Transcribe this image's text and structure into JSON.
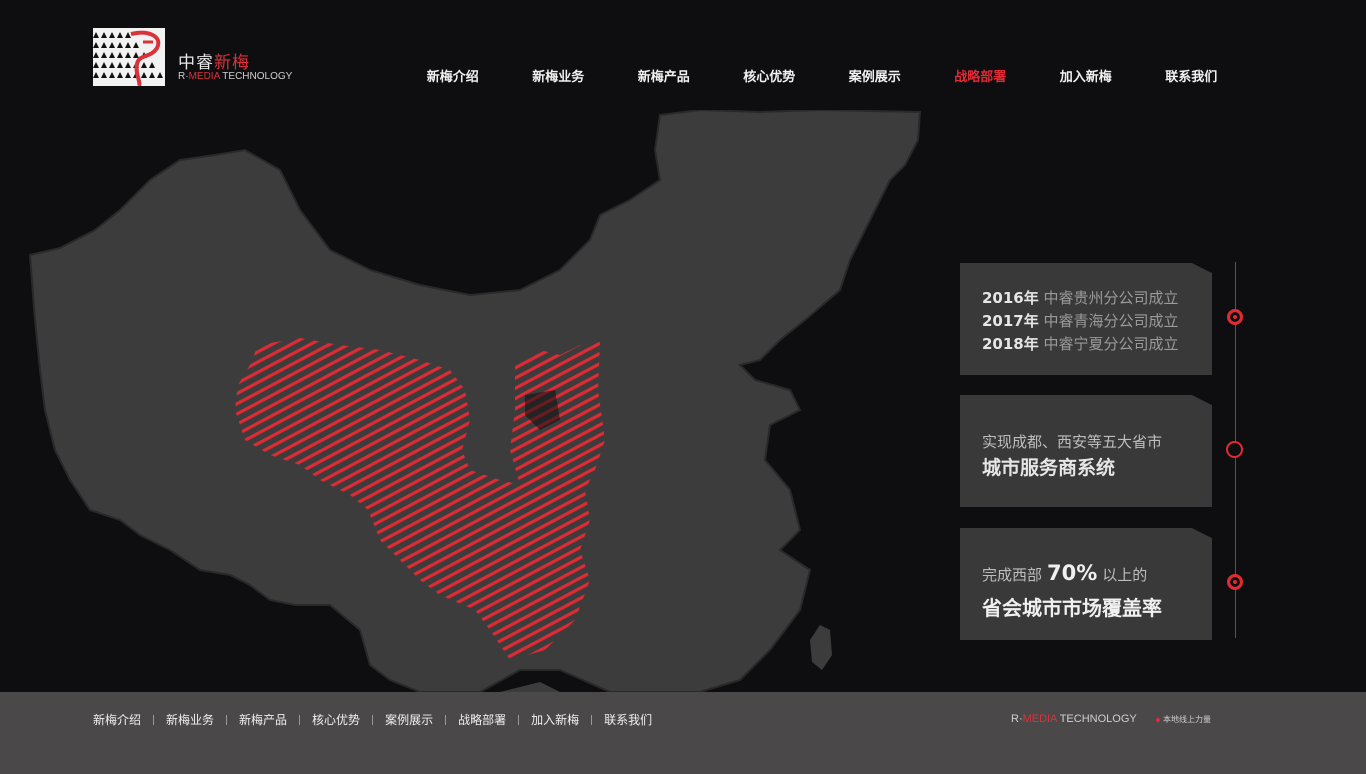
{
  "logo": {
    "cn_part1": "中睿",
    "cn_part2": "新梅",
    "en_prefix": "R·",
    "en_red": "MEDIA",
    "en_suffix": " TECHNOLOGY"
  },
  "nav": {
    "items": [
      {
        "label": "新梅介绍"
      },
      {
        "label": "新梅业务"
      },
      {
        "label": "新梅产品"
      },
      {
        "label": "核心优势"
      },
      {
        "label": "案例展示"
      },
      {
        "label": "战略部署"
      },
      {
        "label": "加入新梅"
      },
      {
        "label": "联系我们"
      }
    ],
    "active_index": 5
  },
  "timeline": {
    "card1": {
      "lines": [
        {
          "year": "2016年",
          "text": " 中睿贵州分公司成立"
        },
        {
          "year": "2017年",
          "text": " 中睿青海分公司成立"
        },
        {
          "year": "2018年",
          "text": " 中睿宁夏分公司成立"
        }
      ]
    },
    "card2": {
      "line1": "实现成都、西安等五大省市",
      "line2": "城市服务商系统"
    },
    "card3": {
      "line1_pre": "完成西部",
      "percent": "70%",
      "line1_post": "以上的",
      "line2": "省会城市市场覆盖率"
    }
  },
  "footer": {
    "nav": [
      "新梅介绍",
      "新梅业务",
      "新梅产品",
      "核心优势",
      "案例展示",
      "战略部署",
      "加入新梅",
      "联系我们"
    ],
    "brand_prefix": "R·",
    "brand_red": "MEDIA",
    "brand_suffix": " TECHNOLOGY",
    "slogan": "本地线上力量"
  },
  "colors": {
    "accent": "#e02a34",
    "background": "#0e0e10",
    "map": "#3d3c3d",
    "footer": "#4b4849"
  }
}
